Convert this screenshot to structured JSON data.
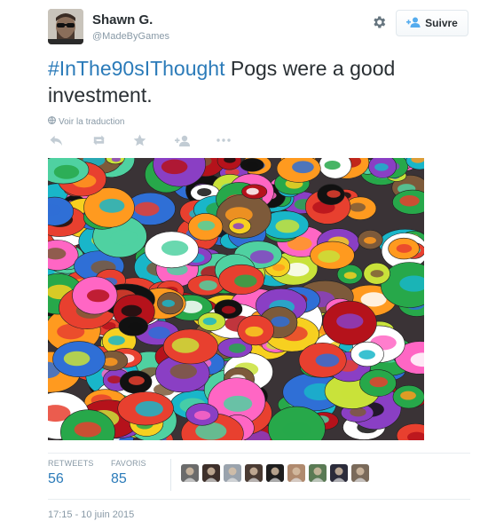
{
  "tweet": {
    "author_name": "Shawn G.",
    "author_handle": "@MadeByGames",
    "hashtag": "#InThe90sIThought",
    "text_rest": " Pogs were a good investment.",
    "translate_label": "Voir la traduction",
    "timestamp": "17:15 - 10 juin 2015"
  },
  "header": {
    "follow_label": "Suivre",
    "follow_icon": "add-user-icon",
    "settings_icon": "gear-icon"
  },
  "actions": [
    {
      "name": "reply-icon",
      "glyph": "↩"
    },
    {
      "name": "retweet-icon",
      "glyph": "⇆"
    },
    {
      "name": "favorite-icon",
      "glyph": "★"
    },
    {
      "name": "follow-user-icon",
      "glyph": "+⚇"
    },
    {
      "name": "more-icon",
      "glyph": "•••"
    }
  ],
  "stats": {
    "retweets_label": "RETWEETS",
    "retweets_count": "56",
    "favorites_label": "FAVORIS",
    "favorites_count": "85"
  },
  "facepile_count": 9,
  "colors": {
    "link": "#2b7bb9",
    "muted": "#8899a6",
    "icon": "#aab8c2"
  }
}
